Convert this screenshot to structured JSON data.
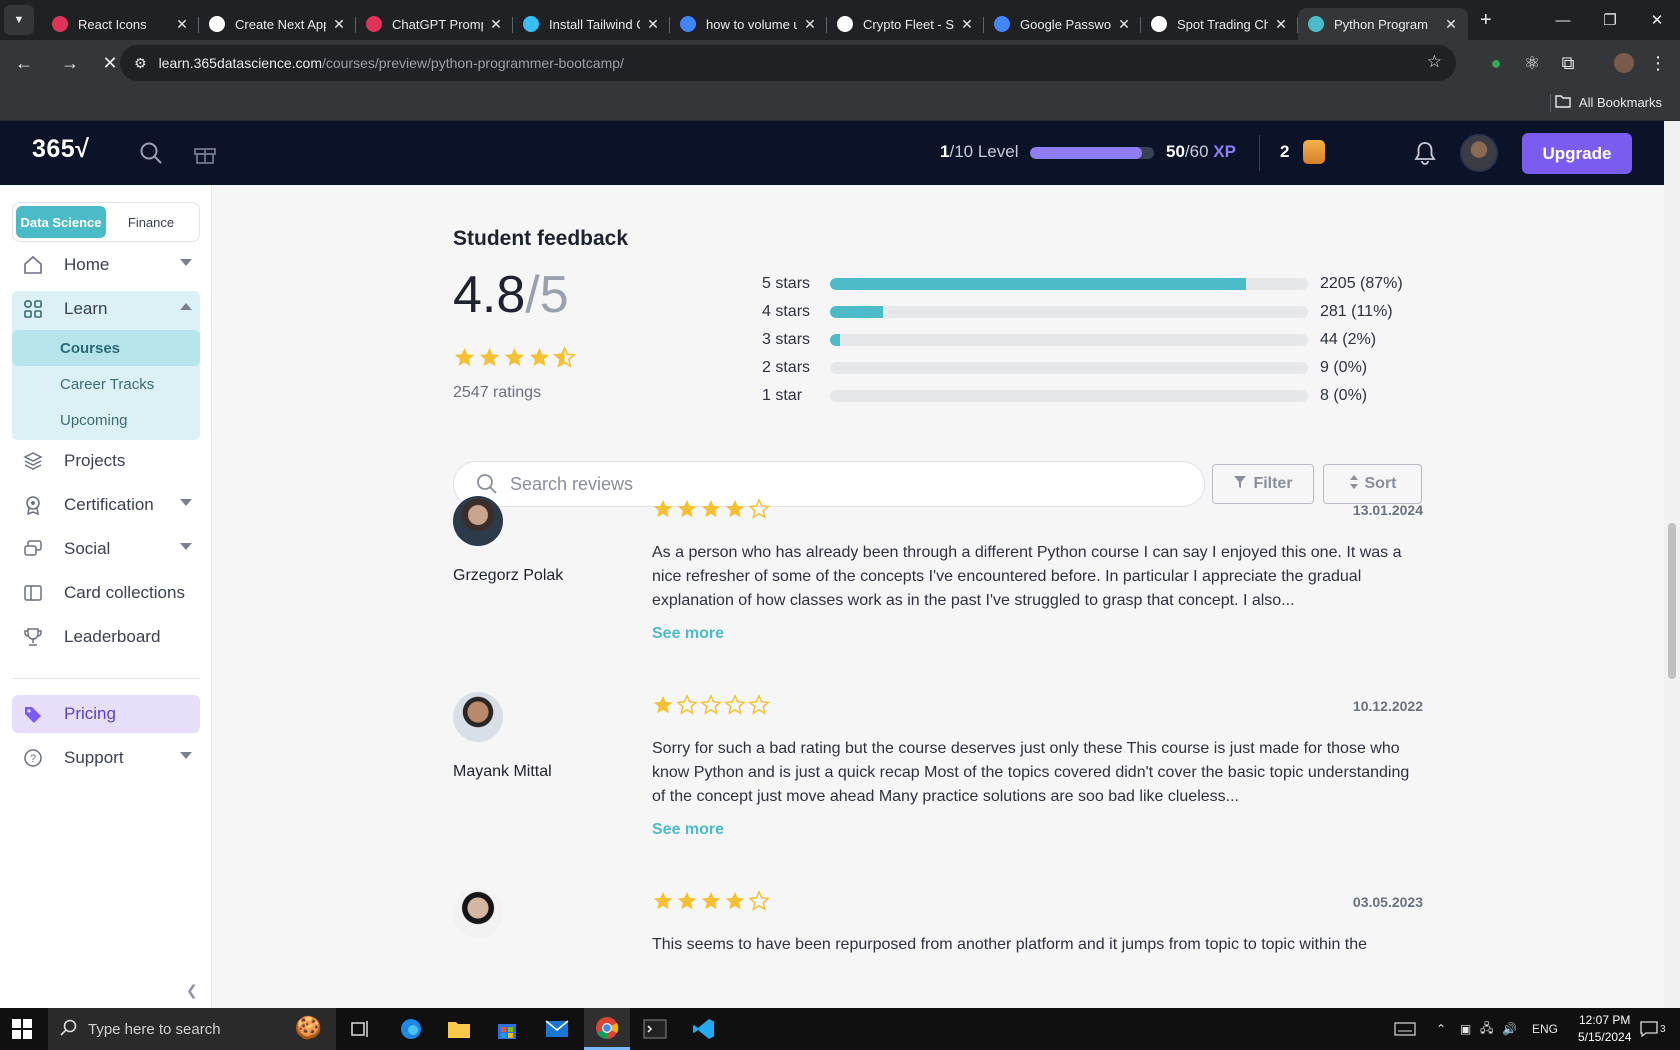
{
  "browser": {
    "tabs": [
      {
        "title": "React Icons",
        "favicon_color": "#e0335a"
      },
      {
        "title": "Create Next App",
        "favicon_color": "#ffffff"
      },
      {
        "title": "ChatGPT Prompt",
        "favicon_color": "#e0335a"
      },
      {
        "title": "Install Tailwind C",
        "favicon_color": "#38bdf8"
      },
      {
        "title": "how to volume u",
        "favicon_color": "#4285f4"
      },
      {
        "title": "Crypto Fleet - Se",
        "favicon_color": "#ffffff"
      },
      {
        "title": "Google Passwor",
        "favicon_color": "#4285f4"
      },
      {
        "title": "Spot Trading Ch",
        "favicon_color": "#ffffff"
      },
      {
        "title": "Python Program",
        "favicon_color": "#4bbcc7",
        "active": true
      }
    ],
    "url_host": "learn.365datascience.com",
    "url_path": "/courses/preview/python-programmer-bootcamp/",
    "all_bookmarks": "All Bookmarks"
  },
  "header": {
    "logo": "365√",
    "level_current": "1",
    "level_total": "/10 Level",
    "level_progress": 0.9,
    "xp_current": "50",
    "xp_total": "/60",
    "xp_label": "XP",
    "coins": "2",
    "upgrade": "Upgrade"
  },
  "sidebar": {
    "segments": [
      "Data Science",
      "Finance"
    ],
    "nav": {
      "home": "Home",
      "learn": "Learn",
      "courses": "Courses",
      "career_tracks": "Career Tracks",
      "upcoming": "Upcoming",
      "projects": "Projects",
      "certification": "Certification",
      "social": "Social",
      "card_collections": "Card collections",
      "leaderboard": "Leaderboard",
      "pricing": "Pricing",
      "support": "Support"
    }
  },
  "feedback": {
    "title": "Student feedback",
    "score": "4.8",
    "out_of": "/5",
    "ratings_count": "2547 ratings",
    "distribution": [
      {
        "label": "5 stars",
        "fraction": 0.87,
        "count": "2205 (87%)"
      },
      {
        "label": "4 stars",
        "fraction": 0.11,
        "count": "281 (11%)"
      },
      {
        "label": "3 stars",
        "fraction": 0.02,
        "count": "44 (2%)"
      },
      {
        "label": "2 stars",
        "fraction": 0,
        "count": "9 (0%)"
      },
      {
        "label": "1 star",
        "fraction": 0,
        "count": "8 (0%)"
      }
    ],
    "search_placeholder": "Search reviews",
    "filter": "Filter",
    "sort": "Sort"
  },
  "reviews": [
    {
      "name": "Grzegorz Polak",
      "stars": 4,
      "date": "13.01.2024",
      "text": "As a person who has already been through a different Python course I can say I enjoyed this one. It was a nice refresher of some of the concepts I've encountered before. In particular I appreciate the gradual explanation of how classes work as in the past I've struggled to grasp that concept. I also...",
      "more": "See more"
    },
    {
      "name": "Mayank Mittal",
      "stars": 1,
      "date": "10.12.2022",
      "text": "Sorry for such a bad rating but the course deserves just only these This course is just made for those who know Python and is just a quick recap Most of the topics covered didn't cover the basic topic understanding of the concept just move ahead Many practice solutions are soo bad like clueless...",
      "more": "See more"
    },
    {
      "name": "",
      "stars": 4,
      "date": "03.05.2023",
      "text": "This seems to have been repurposed from another platform and it jumps from topic to topic within the",
      "more": ""
    }
  ],
  "taskbar": {
    "search_placeholder": "Type here to search",
    "language": "ENG",
    "time": "12:07 PM",
    "date": "5/15/2024",
    "notifications": "3"
  },
  "colors": {
    "accent": "#4bbcc7",
    "brand_purple": "#7b5cf0",
    "header_bg": "#0b1329",
    "star": "#f5c032"
  }
}
